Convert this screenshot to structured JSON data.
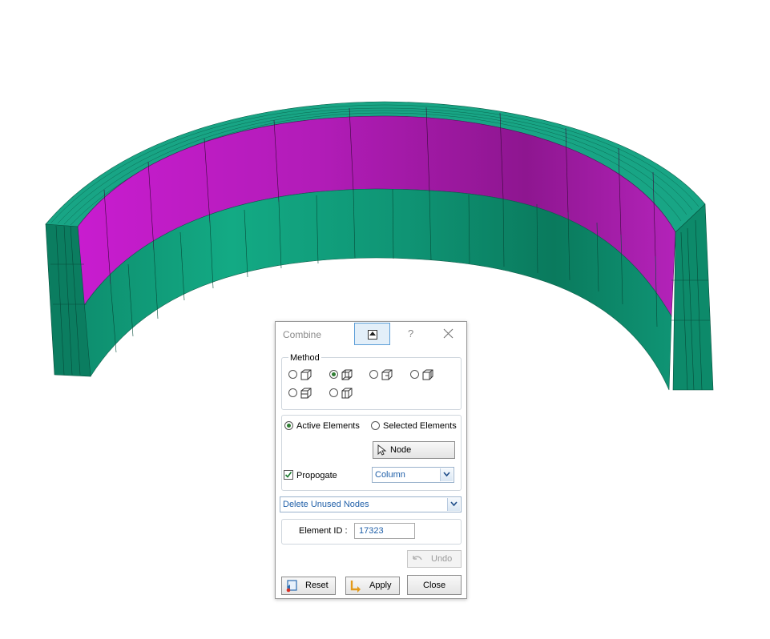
{
  "dialog": {
    "title": "Combine",
    "help_label": "?",
    "method_label": "Method",
    "methods": [
      {
        "icon": "cube-method-1-icon",
        "selected": false
      },
      {
        "icon": "cube-method-2-icon",
        "selected": true
      },
      {
        "icon": "cube-method-3-icon",
        "selected": false
      },
      {
        "icon": "cube-method-4-icon",
        "selected": false
      },
      {
        "icon": "cube-method-5-icon",
        "selected": false
      },
      {
        "icon": "cube-method-6-icon",
        "selected": false
      }
    ],
    "scope": {
      "active_label": "Active Elements",
      "selected_label": "Selected Elements",
      "active_selected": true
    },
    "node_button_label": "Node",
    "propagate": {
      "label": "Propogate",
      "checked": true
    },
    "propagate_combo_value": "Column",
    "nodes_combo_value": "Delete Unused Nodes",
    "element_id": {
      "label": "Element ID :",
      "value": "17323"
    },
    "undo_label": "Undo",
    "reset_label": "Reset",
    "apply_label": "Apply",
    "close_label": "Close"
  },
  "colors": {
    "mesh_green": "#0a9a76",
    "mesh_magenta": "#c81ccf",
    "accent_blue": "#5d9fd8"
  }
}
